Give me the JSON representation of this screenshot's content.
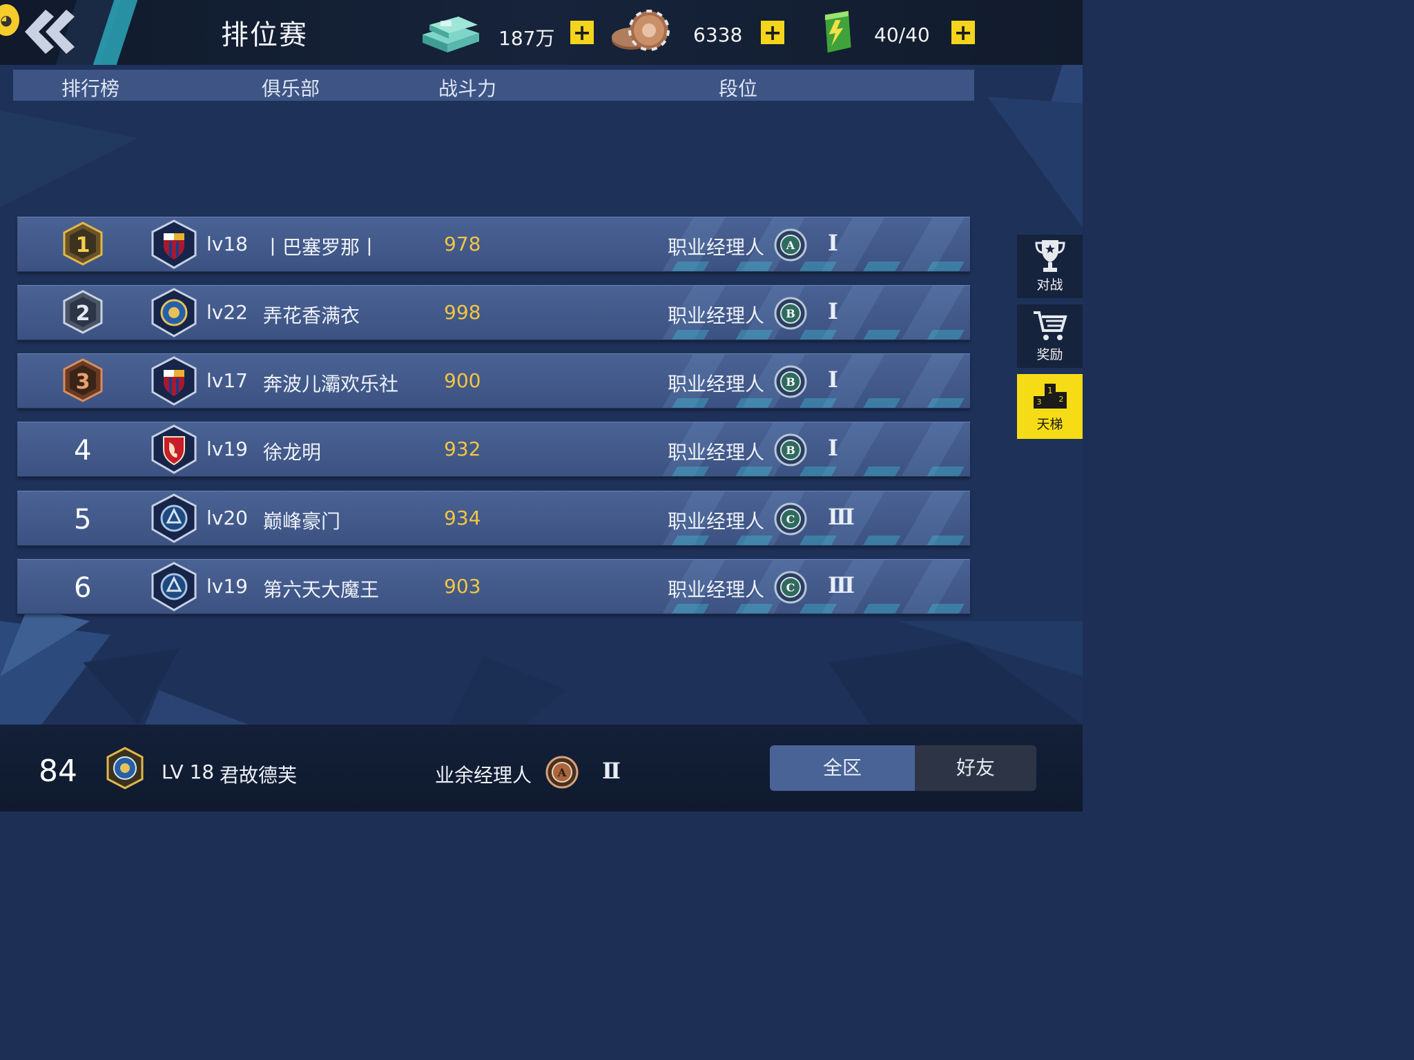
{
  "header": {
    "title": "排位赛",
    "back_icon": "double-chevron-left-icon",
    "resources": [
      {
        "name": "cash",
        "icon": "money-stack-icon",
        "value": "187万"
      },
      {
        "name": "coins",
        "icon": "coin-chips-icon",
        "value": "6338"
      },
      {
        "name": "energy",
        "icon": "battery-icon",
        "value": "40/40"
      }
    ]
  },
  "columns": {
    "rank": "排行榜",
    "club": "俱乐部",
    "power": "战斗力",
    "tier": "段位"
  },
  "rows": [
    {
      "rank": "1",
      "level": "lv18",
      "club": "丨巴塞罗那丨",
      "power": "978",
      "tier": "职业经理人",
      "tier_badge": "A",
      "division": "Ⅰ"
    },
    {
      "rank": "2",
      "level": "lv22",
      "club": "弄花香满衣",
      "power": "998",
      "tier": "职业经理人",
      "tier_badge": "B",
      "division": "Ⅰ"
    },
    {
      "rank": "3",
      "level": "lv17",
      "club": "奔波儿灞欢乐社",
      "power": "900",
      "tier": "职业经理人",
      "tier_badge": "B",
      "division": "Ⅰ"
    },
    {
      "rank": "4",
      "level": "lv19",
      "club": "徐龙明",
      "power": "932",
      "tier": "职业经理人",
      "tier_badge": "B",
      "division": "Ⅰ"
    },
    {
      "rank": "5",
      "level": "lv20",
      "club": "巅峰豪门",
      "power": "934",
      "tier": "职业经理人",
      "tier_badge": "C",
      "division": "Ⅲ"
    },
    {
      "rank": "6",
      "level": "lv19",
      "club": "第六天大魔王",
      "power": "903",
      "tier": "职业经理人",
      "tier_badge": "C",
      "division": "Ⅲ"
    }
  ],
  "side_nav": [
    {
      "label": "对战",
      "icon": "trophy-icon",
      "active": false
    },
    {
      "label": "奖励",
      "icon": "shopping-cart-icon",
      "active": false
    },
    {
      "label": "天梯",
      "icon": "podium-icon",
      "active": true
    }
  ],
  "me": {
    "rank": "84",
    "level": "LV 18",
    "name": "君故德芙",
    "tier": "业余经理人",
    "tier_badge": "A",
    "division": "Ⅱ"
  },
  "tabs": {
    "all": "全区",
    "friends": "好友",
    "selected": "all"
  },
  "colors": {
    "accent_yellow": "#f6dc16",
    "power_gold": "#f3c640",
    "row_blue": "#4a6294",
    "header_blue": "#3d5485"
  }
}
